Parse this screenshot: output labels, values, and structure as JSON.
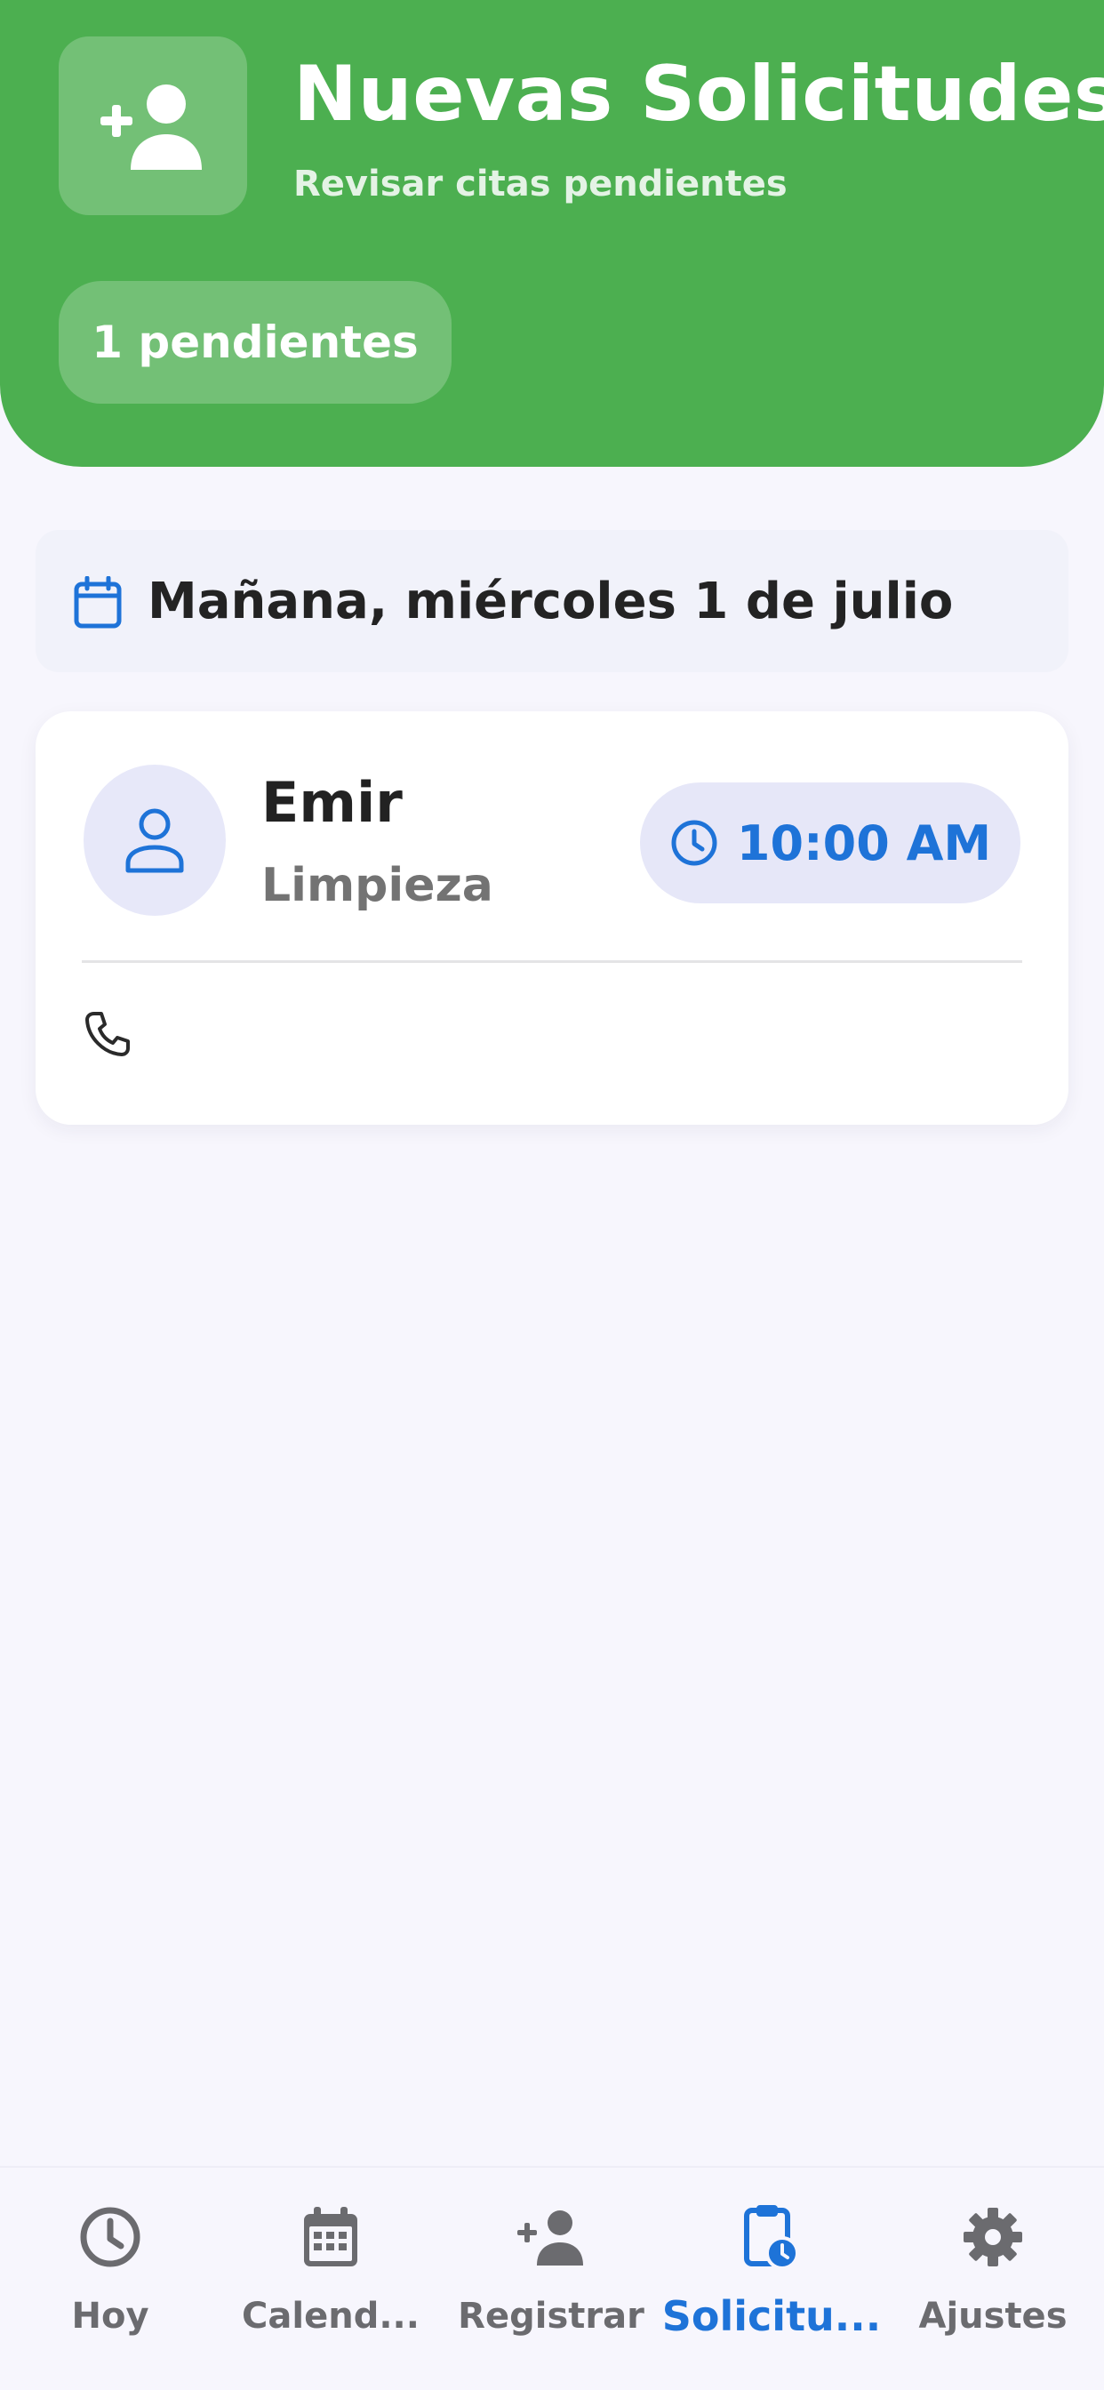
{
  "header": {
    "title": "Nuevas Solicitudes",
    "subtitle": "Revisar citas pendientes",
    "pending_badge": "1 pendientes",
    "icon": "person-add-icon"
  },
  "date_banner": {
    "icon": "calendar-icon",
    "text": "Mañana, miércoles 1 de julio"
  },
  "request": {
    "client_name": "Emir",
    "service": "Limpieza",
    "time": "10:00 AM",
    "phone": "",
    "icons": {
      "avatar": "person-outline-icon",
      "time": "clock-icon",
      "phone": "phone-icon"
    }
  },
  "bottom_nav": {
    "items": [
      {
        "label": "Hoy",
        "icon": "clock-icon",
        "active": false
      },
      {
        "label": "Calend...",
        "icon": "calendar-grid-icon",
        "active": false
      },
      {
        "label": "Registrar",
        "icon": "person-add-icon",
        "active": false
      },
      {
        "label": "Solicitu...",
        "icon": "clipboard-clock-icon",
        "active": true
      },
      {
        "label": "Ajustes",
        "icon": "gear-icon",
        "active": false
      }
    ]
  },
  "colors": {
    "header_green": "#4CAF50",
    "accent_blue": "#1E73D8",
    "background": "#F7F6FD",
    "nav_inactive": "#6B6B6F"
  }
}
